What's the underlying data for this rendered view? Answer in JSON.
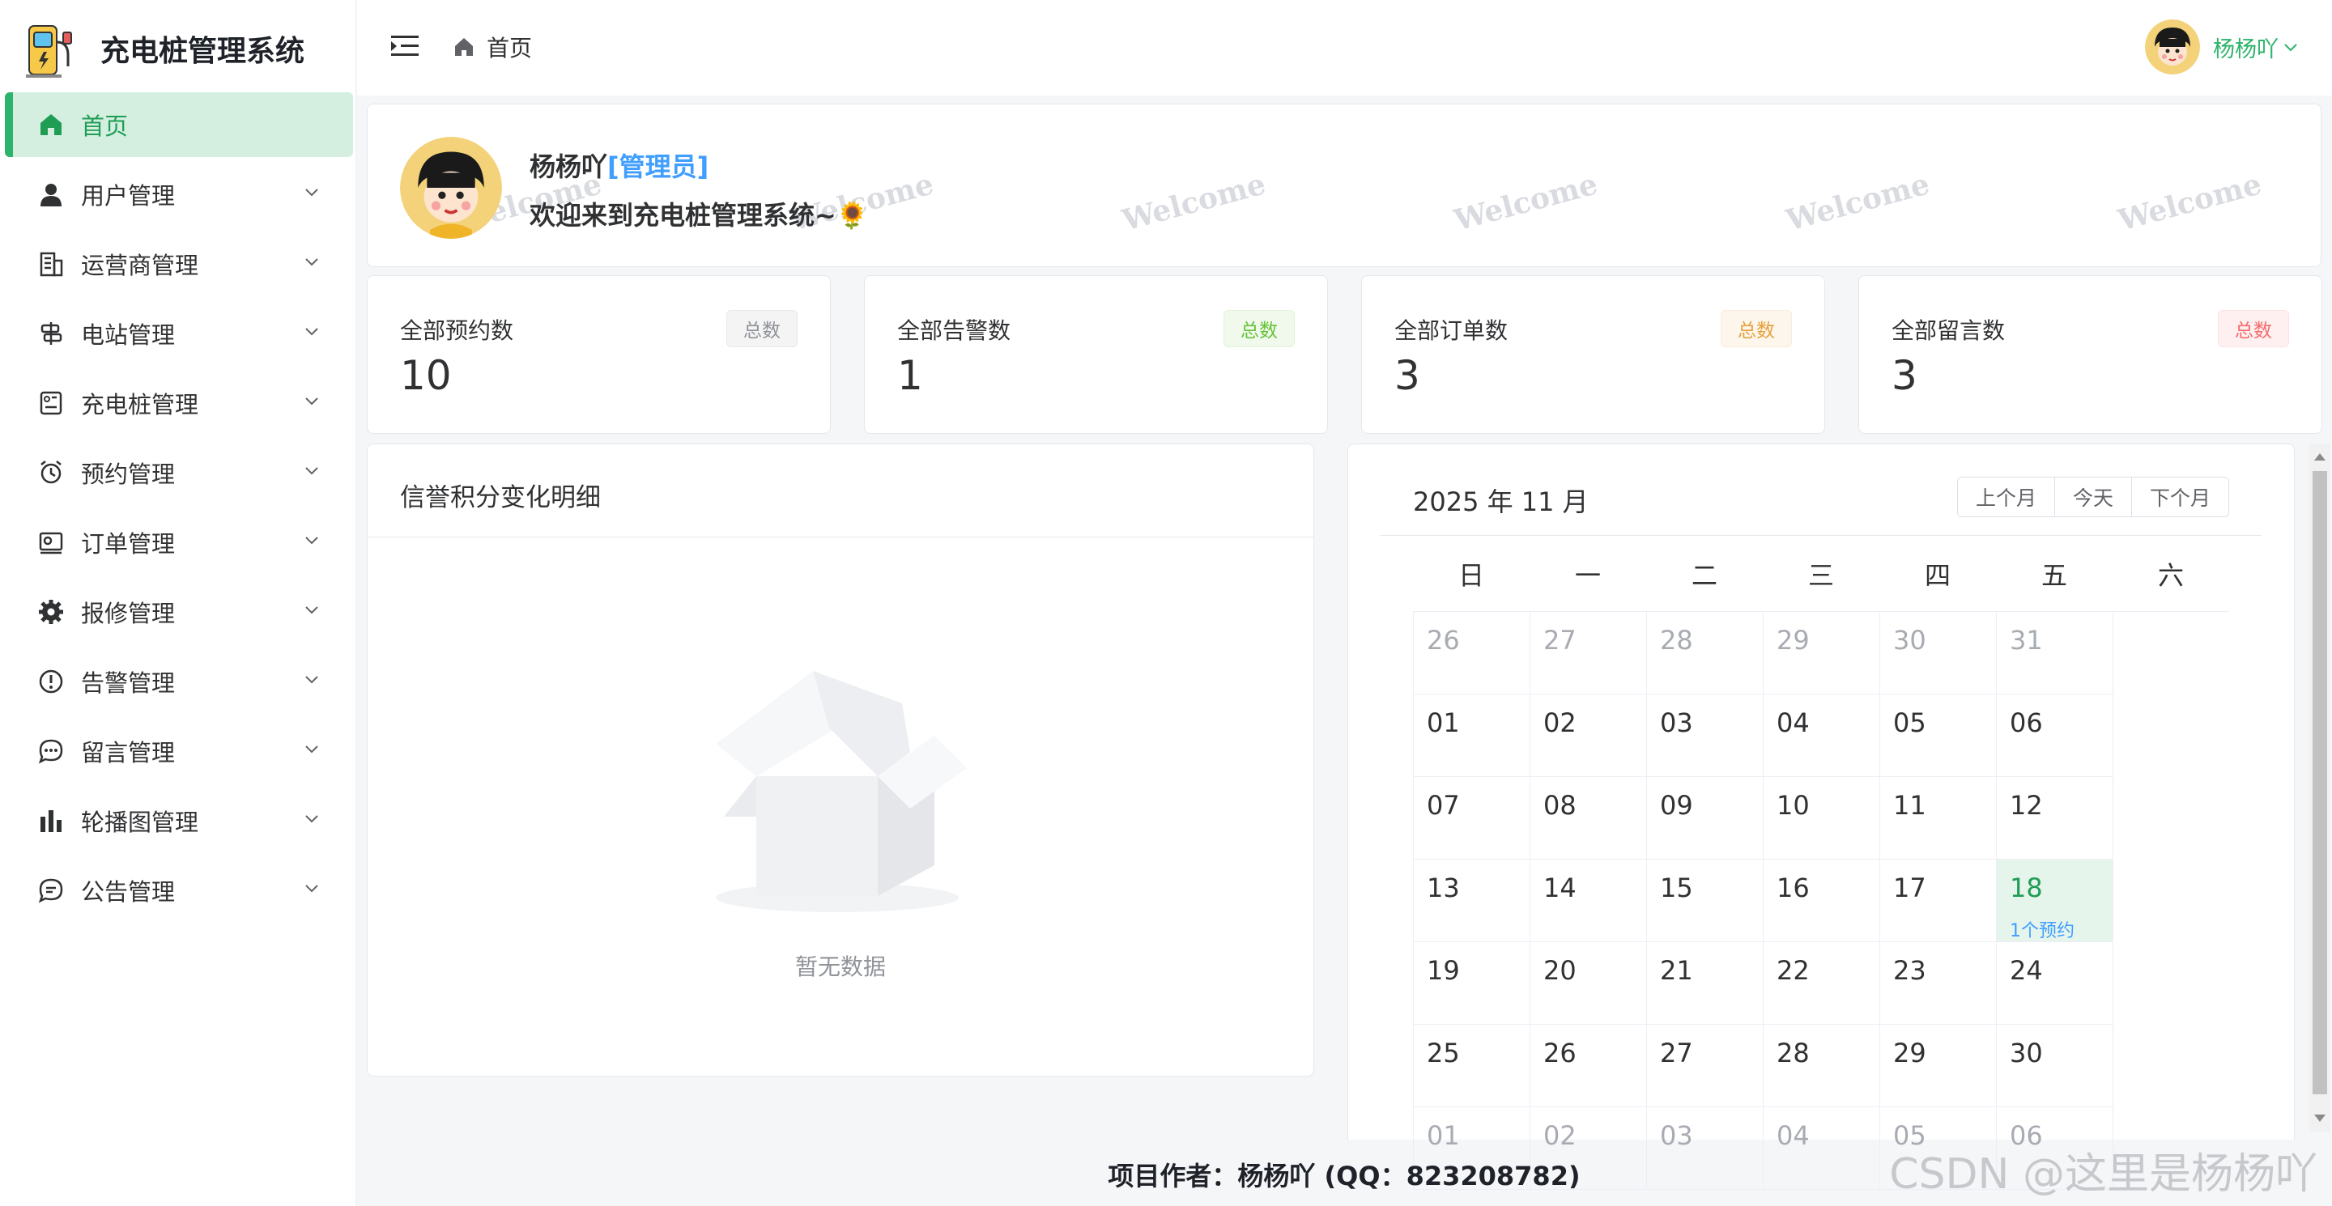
{
  "app": {
    "title": "充电桩管理系统"
  },
  "sidebar": {
    "items": [
      {
        "label": "首页",
        "icon": "home-icon",
        "active": true
      },
      {
        "label": "用户管理",
        "icon": "user-icon"
      },
      {
        "label": "运营商管理",
        "icon": "building-icon"
      },
      {
        "label": "电站管理",
        "icon": "signpost-icon"
      },
      {
        "label": "充电桩管理",
        "icon": "charger-icon"
      },
      {
        "label": "预约管理",
        "icon": "alarm-clock-icon"
      },
      {
        "label": "订单管理",
        "icon": "order-icon"
      },
      {
        "label": "报修管理",
        "icon": "gear-icon"
      },
      {
        "label": "告警管理",
        "icon": "warning-icon"
      },
      {
        "label": "留言管理",
        "icon": "chat-icon"
      },
      {
        "label": "轮播图管理",
        "icon": "bar-chart-icon"
      },
      {
        "label": "公告管理",
        "icon": "message-icon"
      }
    ]
  },
  "header": {
    "breadcrumb": "首页",
    "username": "杨杨吖"
  },
  "welcome": {
    "name": "杨杨吖",
    "role": "[管理员]",
    "message": "欢迎来到充电桩管理系统~🌻",
    "watermark": "Welcome"
  },
  "stats": [
    {
      "label": "全部预约数",
      "value": "10",
      "tag": "总数",
      "color": "#909399"
    },
    {
      "label": "全部告警数",
      "value": "1",
      "tag": "总数",
      "color": "#67c23a"
    },
    {
      "label": "全部订单数",
      "value": "3",
      "tag": "总数",
      "color": "#e6a23c"
    },
    {
      "label": "全部留言数",
      "value": "3",
      "tag": "总数",
      "color": "#f56c6c"
    }
  ],
  "credit": {
    "title": "信誉积分变化明细",
    "empty_text": "暂无数据"
  },
  "calendar": {
    "title": "2025 年 11 月",
    "buttons": [
      "上个月",
      "今天",
      "下个月"
    ],
    "weekdays": [
      "日",
      "一",
      "二",
      "三",
      "四",
      "五",
      "六"
    ],
    "cells": [
      {
        "d": "26",
        "other": true
      },
      {
        "d": "27",
        "other": true
      },
      {
        "d": "28",
        "other": true
      },
      {
        "d": "29",
        "other": true
      },
      {
        "d": "30",
        "other": true
      },
      {
        "d": "31",
        "other": true
      },
      {
        "d": "01"
      },
      {
        "d": "02"
      },
      {
        "d": "03"
      },
      {
        "d": "04"
      },
      {
        "d": "05"
      },
      {
        "d": "06"
      },
      {
        "d": "07"
      },
      {
        "d": "08"
      },
      {
        "d": "09"
      },
      {
        "d": "10"
      },
      {
        "d": "11"
      },
      {
        "d": "12"
      },
      {
        "d": "13"
      },
      {
        "d": "14"
      },
      {
        "d": "15"
      },
      {
        "d": "16"
      },
      {
        "d": "17"
      },
      {
        "d": "18",
        "today": true,
        "note": "1个预约"
      },
      {
        "d": "19"
      },
      {
        "d": "20"
      },
      {
        "d": "21"
      },
      {
        "d": "22"
      },
      {
        "d": "23"
      },
      {
        "d": "24"
      },
      {
        "d": "25"
      },
      {
        "d": "26"
      },
      {
        "d": "27"
      },
      {
        "d": "28"
      },
      {
        "d": "29"
      },
      {
        "d": "30"
      },
      {
        "d": "01",
        "other": true
      },
      {
        "d": "02",
        "other": true
      },
      {
        "d": "03",
        "other": true
      },
      {
        "d": "04",
        "other": true
      },
      {
        "d": "05",
        "other": true
      },
      {
        "d": "06",
        "other": true
      }
    ]
  },
  "footer": {
    "text": "项目作者：杨杨吖 (QQ：823208782)"
  },
  "watermark": "CSDN @这里是杨杨吖"
}
